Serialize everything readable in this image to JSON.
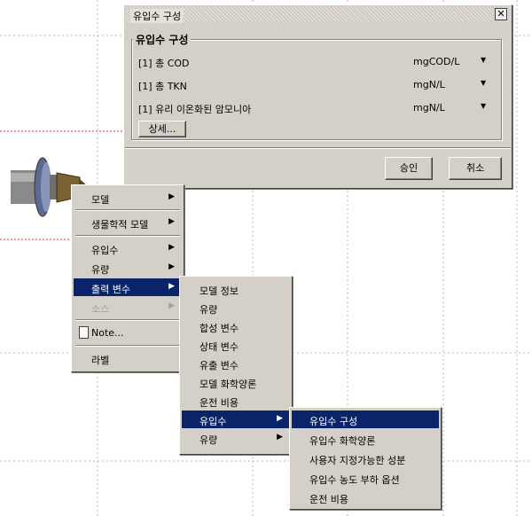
{
  "dialog": {
    "title": "유입수 구성",
    "group_title": "유입수 구성",
    "rows": [
      {
        "label": "[1] 총 COD",
        "unit": "mgCOD/L"
      },
      {
        "label": "[1] 총 TKN",
        "unit": "mgN/L"
      },
      {
        "label": "[1] 유리 이온화된 암모니아",
        "unit": "mgN/L"
      }
    ],
    "detail_button": "상세...",
    "ok_button": "승인",
    "cancel_button": "취소"
  },
  "context_menu": {
    "items": [
      "모델",
      "생물학적 모델",
      "유입수",
      "유량",
      "출력 변수",
      "소스",
      "Note...",
      "라벨"
    ]
  },
  "output_submenu": {
    "items": [
      "모델 정보",
      "유량",
      "합성 변수",
      "상태 변수",
      "유출 변수",
      "모델 화학양론",
      "운전 비용",
      "유입수",
      "유량"
    ]
  },
  "influent_submenu": {
    "items": [
      "유입수 구성",
      "유입수 화학양론",
      "사용자 지정가능한 성분",
      "유입수 농도 부하 옵션",
      "운전 비용"
    ]
  },
  "colors": {
    "selection": "#0a246a",
    "menu_bg": "#d4d0c8",
    "dotted_red": "#e03030"
  }
}
